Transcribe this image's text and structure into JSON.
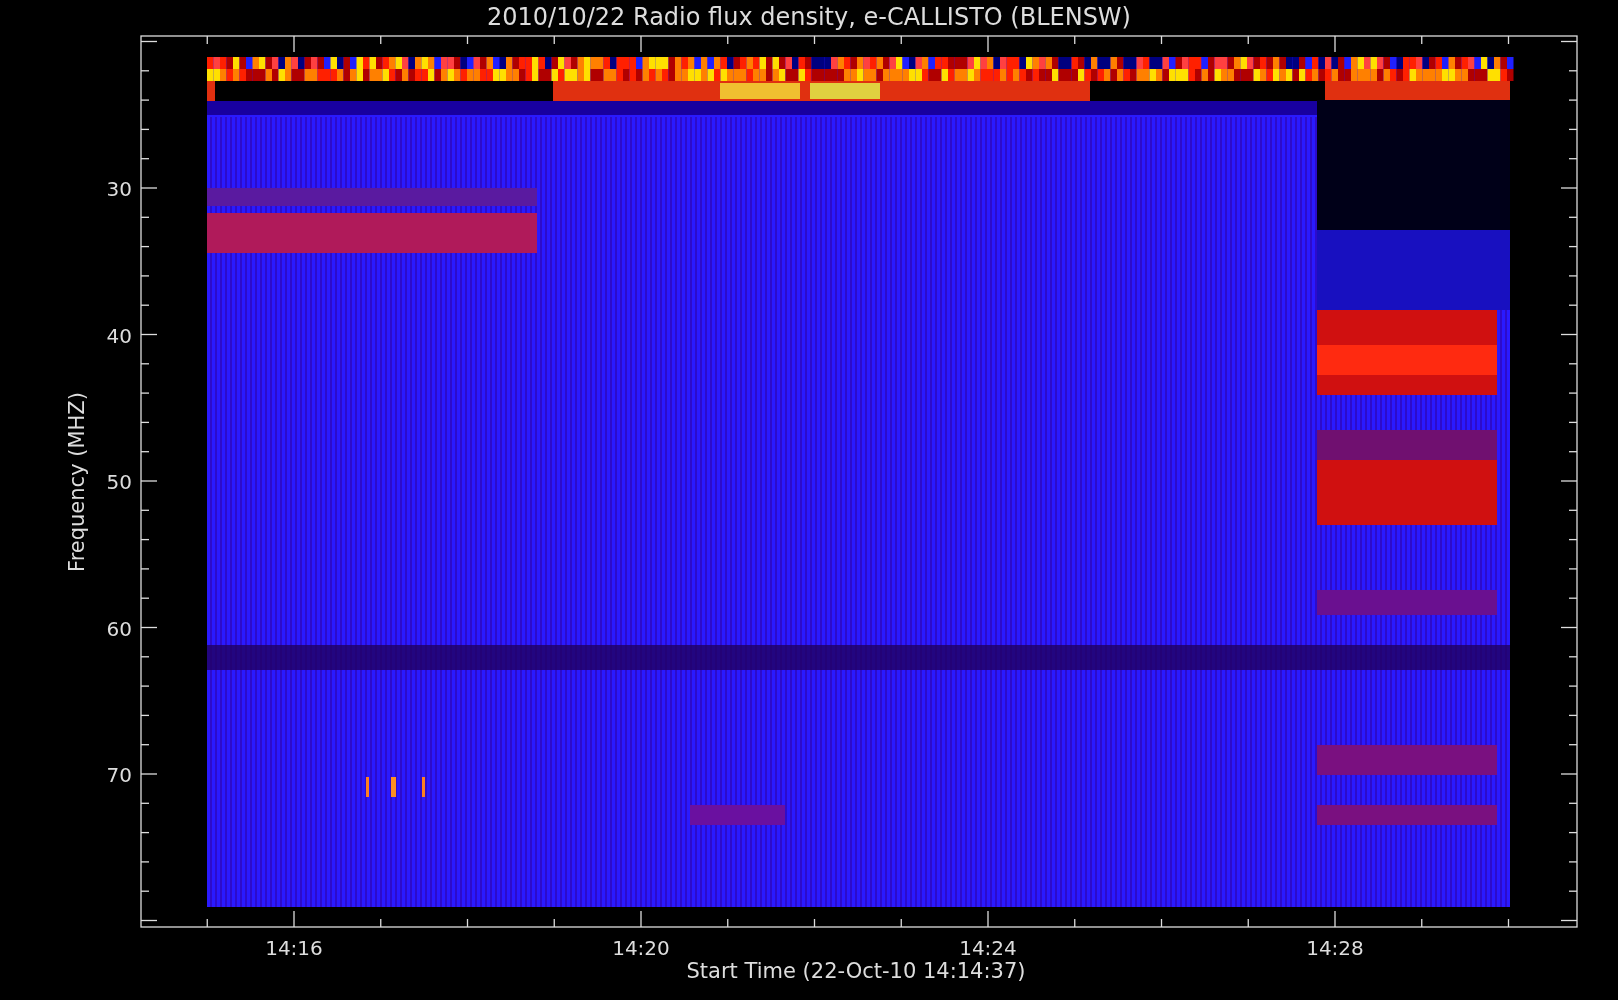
{
  "title": "2010/10/22  Radio flux density, e-CALLISTO (BLENSW)",
  "y_axis": {
    "label": "Frequency (MHZ)",
    "ticks": [
      "30",
      "40",
      "50",
      "60",
      "70"
    ]
  },
  "x_axis": {
    "label": "Start Time (22-Oct-10 14:14:37)",
    "ticks": [
      "14:16",
      "14:20",
      "14:24",
      "14:28"
    ]
  }
}
